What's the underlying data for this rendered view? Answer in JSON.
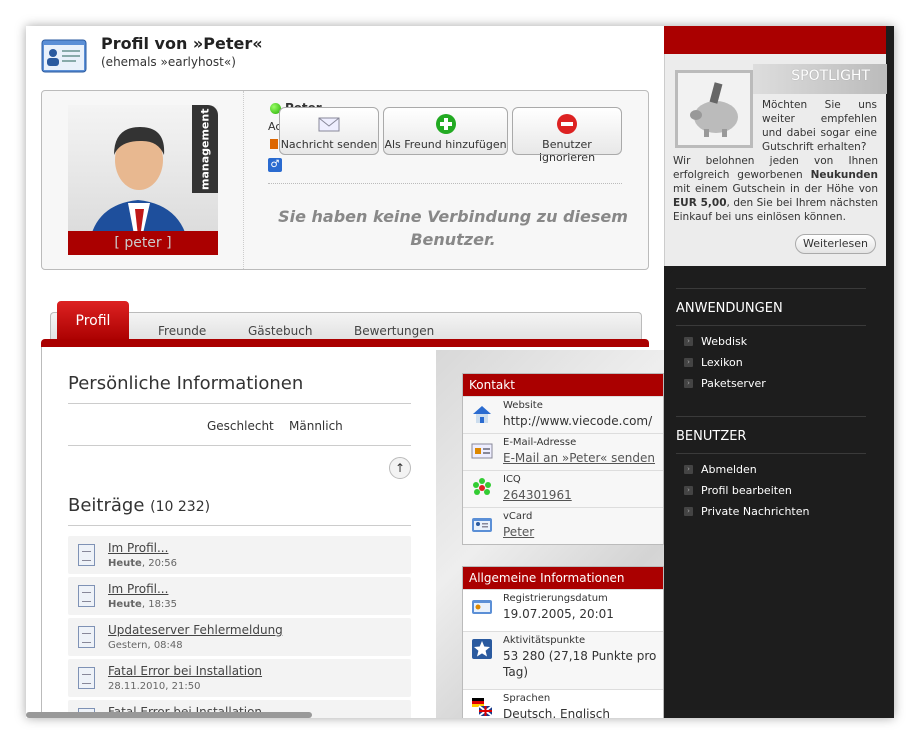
{
  "profile": {
    "title": "Profil von »Peter«",
    "subtitle": "(ehemals »earlyhost«)",
    "avatar_tag": "management",
    "avatar_name": "[ peter ]",
    "online_name": "Peter",
    "small_label": "Ac",
    "no_connection": "Sie haben keine Verbindung zu diesem Benutzer.",
    "actions": {
      "message": "Nachricht senden",
      "add_friend": "Als Freund hinzufügen",
      "ignore": "Benutzer ignorieren"
    }
  },
  "tabs": {
    "active": "Profil",
    "items": [
      "Freunde",
      "Gästebuch",
      "Bewertungen"
    ]
  },
  "personal": {
    "title": "Persönliche Informationen",
    "gender_label": "Geschlecht",
    "gender_value": "Männlich"
  },
  "posts": {
    "title": "Beiträge",
    "count": "(10 232)",
    "items": [
      {
        "title": "Im Profil...",
        "date_bold": "Heute",
        "date_rest": ", 20:56"
      },
      {
        "title": "Im Profil...",
        "date_bold": "Heute",
        "date_rest": ", 18:35"
      },
      {
        "title": "Updateserver Fehlermeldung",
        "date_bold": "",
        "date_rest": "Gestern, 08:48"
      },
      {
        "title": "Fatal Error bei Installation",
        "date_bold": "",
        "date_rest": "28.11.2010, 21:50"
      },
      {
        "title": "Fatal Error bei Installation",
        "date_bold": "",
        "date_rest": ""
      }
    ]
  },
  "contact": {
    "title": "Kontakt",
    "rows": [
      {
        "label": "Website",
        "value": "http://www.viecode.com/"
      },
      {
        "label": "E-Mail-Adresse",
        "value": "E-Mail an »Peter« senden"
      },
      {
        "label": "ICQ",
        "value": "264301961"
      },
      {
        "label": "vCard",
        "value": "Peter"
      }
    ]
  },
  "general": {
    "title": "Allgemeine Informationen",
    "rows": [
      {
        "label": "Registrierungsdatum",
        "value": "19.07.2005, 20:01"
      },
      {
        "label": "Aktivitätspunkte",
        "value": "53 280 (27,18 Punkte pro Tag)"
      },
      {
        "label": "Sprachen",
        "value": "Deutsch, Englisch"
      }
    ]
  },
  "spotlight": {
    "title": "SPOTLIGHT",
    "text1": "Möchten Sie uns weiter empfehlen und dabei sogar eine Gutschrift erhalten?",
    "text2_a": "Wir belohnen jeden von Ihnen erfolgreich geworbenen ",
    "text2_b": "Neukunden",
    "text2_c": " mit einem Gutschein in der Höhe von ",
    "text2_d": "EUR 5,00",
    "text2_e": ", den Sie bei Ihrem nächsten Einkauf bei uns einlösen können.",
    "button": "Weiterlesen"
  },
  "sidebar": {
    "apps_title": "ANWENDUNGEN",
    "apps": [
      "Webdisk",
      "Lexikon",
      "Paketserver"
    ],
    "user_title": "BENUTZER",
    "user": [
      "Abmelden",
      "Profil bearbeiten",
      "Private Nachrichten"
    ]
  },
  "colors": {
    "accent": "#aa0000",
    "sidebar_bg": "#1d1d1d"
  }
}
